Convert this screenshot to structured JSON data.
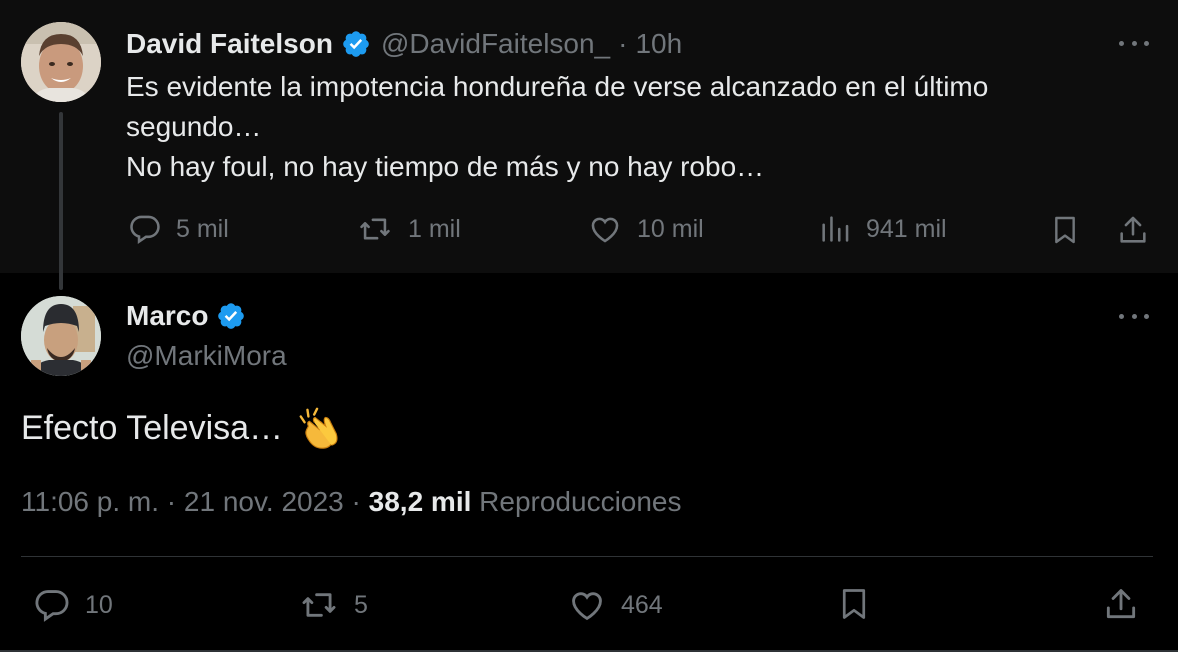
{
  "parent_tweet": {
    "author_name": "David Faitelson",
    "author_handle": "@DavidFaitelson_",
    "separator": "·",
    "time_ago": "10h",
    "text_lines": [
      "Es evidente la impotencia hondureña de verse alcanzado en el último",
      "segundo…",
      "No hay foul, no hay tiempo de más y no hay robo…"
    ],
    "stats": {
      "replies": "5 mil",
      "reposts": "1 mil",
      "likes": "10 mil",
      "views": "941 mil"
    }
  },
  "main_tweet": {
    "author_name": "Marco",
    "author_handle": "@MarkiMora",
    "text": "Efecto Televisa…",
    "emoji": "clapping-hands",
    "meta": {
      "time": "11:06 p. m.",
      "separator": "·",
      "date": "21 nov. 2023",
      "separator2": "·",
      "views_count": "38,2 mil",
      "views_label": "Reproducciones"
    },
    "stats": {
      "replies": "10",
      "reposts": "5",
      "likes": "464"
    }
  },
  "icons": {
    "verified": "verified-badge-icon",
    "more": "more-options-icon",
    "reply": "reply-icon",
    "repost": "repost-icon",
    "like": "heart-icon",
    "views": "analytics-icon",
    "bookmark": "bookmark-icon",
    "share": "share-icon"
  },
  "colors": {
    "background": "#000000",
    "parent_background": "#0d0d0d",
    "text_primary": "#e7e9ea",
    "text_muted": "#71767b",
    "verified_blue": "#1d9bf0"
  }
}
